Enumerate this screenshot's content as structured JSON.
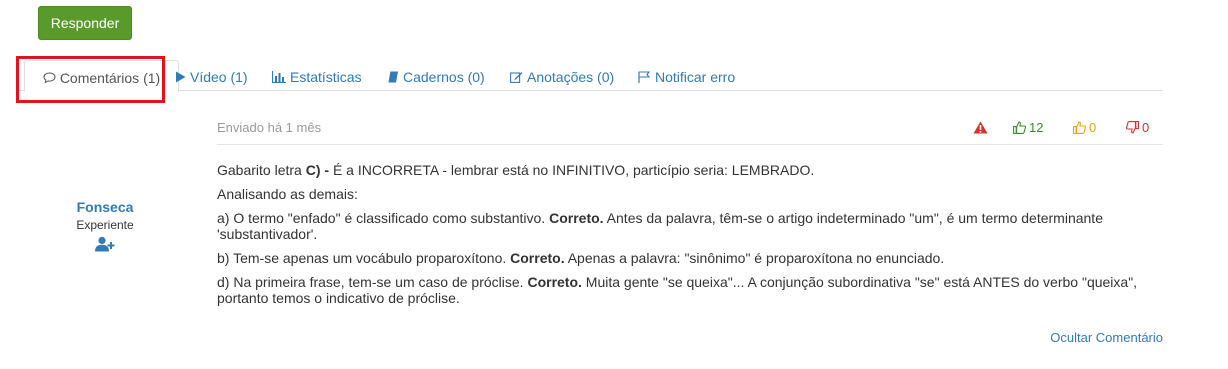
{
  "reply_button": "Responder",
  "tabs": {
    "comments": "Comentários (1)",
    "video": "Vídeo (1)",
    "stats": "Estatísticas",
    "notebooks": "Cadernos (0)",
    "notes": "Anotações (0)",
    "report": "Notificar erro"
  },
  "author": {
    "name": "Fonseca",
    "role": "Experiente"
  },
  "comment": {
    "sent": "Enviado há 1 mês",
    "likes": "12",
    "neutral": "0",
    "dislikes": "0",
    "p1_a": "Gabarito letra ",
    "p1_b": "C) - ",
    "p1_c": "É a INCORRETA - lembrar está no INFINITIVO, particípio seria: LEMBRADO.",
    "p2": "Analisando as demais:",
    "p3_a": "a) O termo \"enfado\" é classificado como substantivo. ",
    "p3_b": "Correto.",
    "p3_c": " Antes da palavra, têm-se o artigo indeterminado \"um\", é um termo determinante 'substantivador'.",
    "p4_a": "b) Tem-se apenas um vocábulo proparoxítono. ",
    "p4_b": "Correto.",
    "p4_c": " Apenas a palavra: \"sinônimo\" é proparoxítona no enunciado.",
    "p5_a": "d) Na primeira frase, tem-se um caso de próclise. ",
    "p5_b": "Correto.",
    "p5_c": " Muita gente \"se queixa\"... A conjunção subordinativa \"se\" está ANTES do verbo \"queixa\", portanto temos o indicativo de próclise.",
    "hide": "Ocultar Comentário"
  },
  "colors": {
    "link": "#337ab7",
    "reply_bg": "#5a9a2a",
    "like": "#3c8a2e",
    "neutral": "#e0a800",
    "dislike": "#d9302c",
    "warning": "#d9302c",
    "highlight": "#e3121c"
  }
}
